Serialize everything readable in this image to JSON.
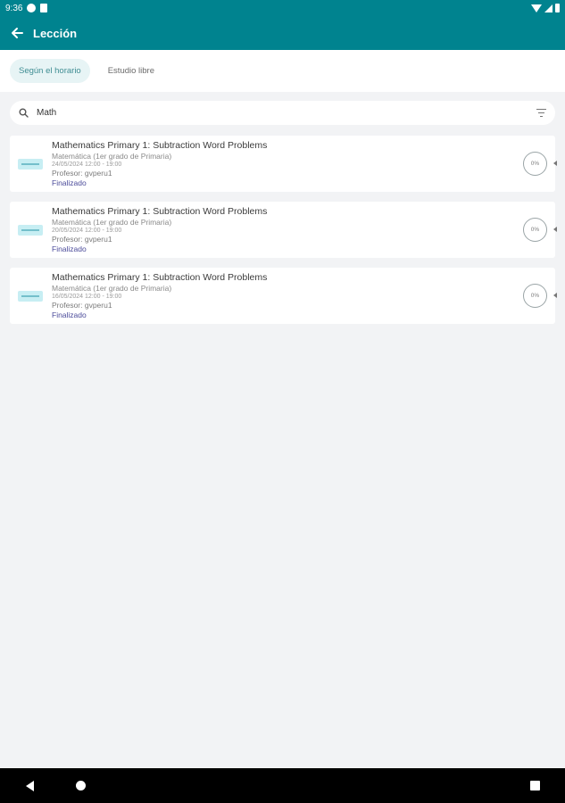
{
  "status_bar": {
    "time": "9:36"
  },
  "app_bar": {
    "title": "Lección"
  },
  "tabs": [
    {
      "label": "Según el horario",
      "active": true
    },
    {
      "label": "Estudio libre",
      "active": false
    }
  ],
  "search": {
    "value": "Math",
    "placeholder": ""
  },
  "lessons": [
    {
      "title": "Mathematics Primary 1: Subtraction Word Problems",
      "subject": "Matemática (1er grado de Primaria)",
      "date": "24/05/2024 12:00 - 19:00",
      "teacher": "Profesor: gvperu1",
      "status": "Finalizado",
      "progress": "0%"
    },
    {
      "title": "Mathematics Primary 1: Subtraction Word Problems",
      "subject": "Matemática (1er grado de Primaria)",
      "date": "20/05/2024 12:00 - 19:00",
      "teacher": "Profesor: gvperu1",
      "status": "Finalizado",
      "progress": "0%"
    },
    {
      "title": "Mathematics Primary 1: Subtraction Word Problems",
      "subject": "Matemática (1er grado de Primaria)",
      "date": "16/05/2024 12:00 - 19:00",
      "teacher": "Profesor: gvperu1",
      "status": "Finalizado",
      "progress": "0%"
    }
  ],
  "colors": {
    "primary": "#00838f",
    "status_text": "#4b4b9a",
    "background": "#f2f3f5"
  }
}
